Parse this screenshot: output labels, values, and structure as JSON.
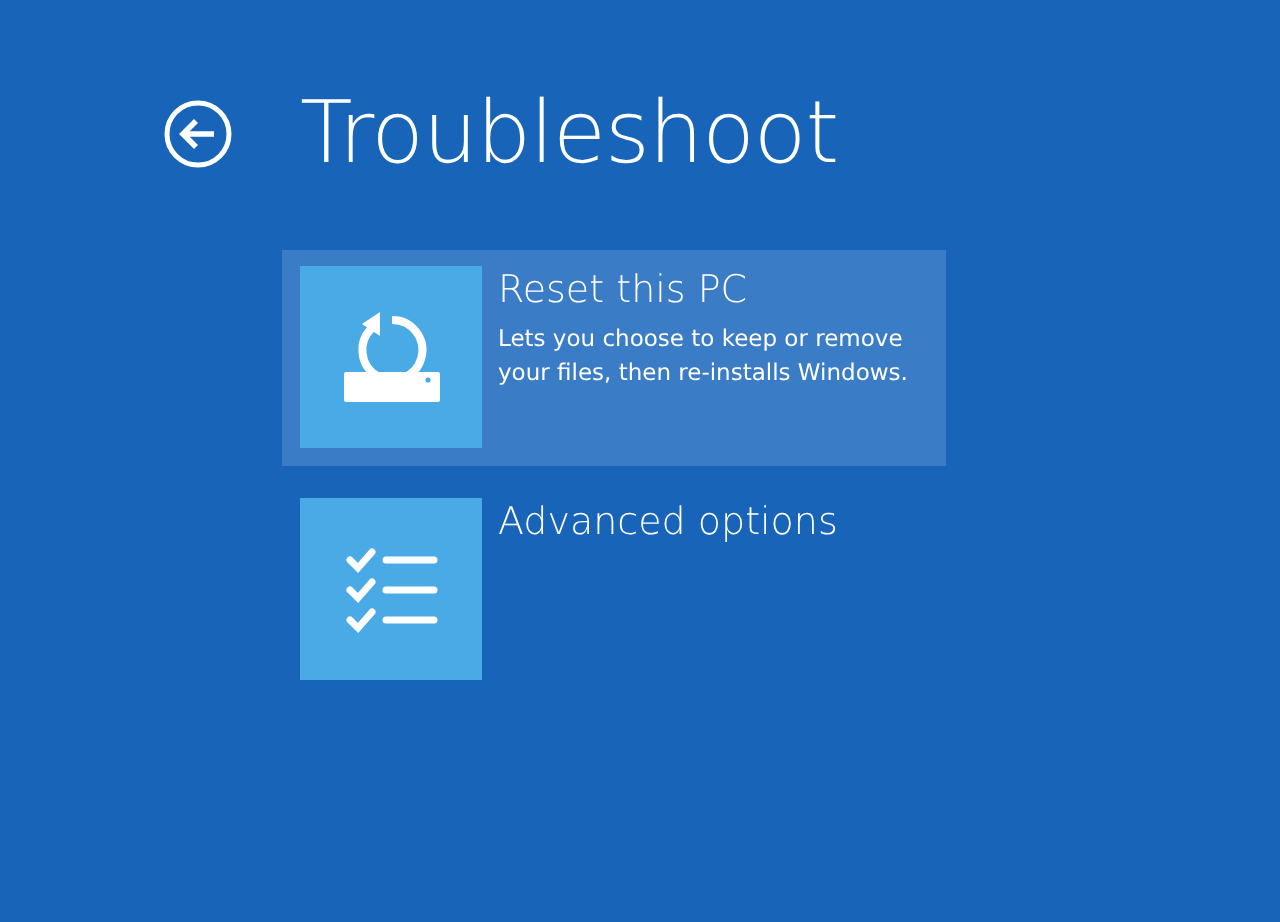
{
  "header": {
    "title": "Troubleshoot"
  },
  "options": [
    {
      "kind": "reset",
      "title": "Reset this PC",
      "description": "Lets you choose to keep or remove your files, then re-installs Windows.",
      "selected": true
    },
    {
      "kind": "advanced",
      "title": "Advanced options",
      "selected": false
    }
  ]
}
